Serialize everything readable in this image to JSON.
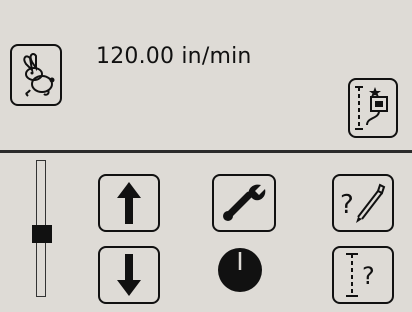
{
  "header": {
    "speed_readout": "120.00 in/min"
  },
  "slider": {
    "level_fraction": 0.45
  },
  "icons": {
    "speed_mode": "rabbit-icon",
    "measure_setup": "measure-tool-icon",
    "jog_up": "arrow-up-icon",
    "jog_down": "arrow-down-icon",
    "tools": "wrench-icon",
    "clock": "clock-icon",
    "probe_help": "probe-help-icon",
    "height_help": "height-help-icon"
  },
  "labels": {
    "help_mark": "?"
  },
  "colors": {
    "background": "#dedbd6",
    "ink": "#111111"
  }
}
